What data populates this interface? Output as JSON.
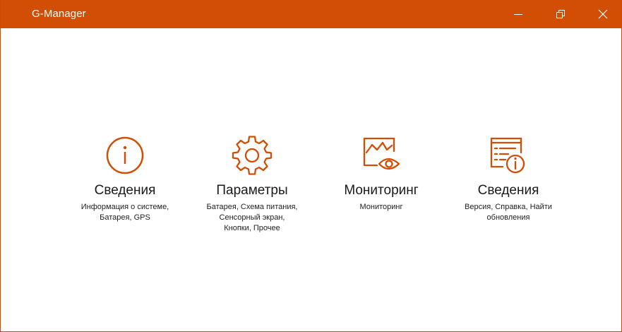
{
  "window": {
    "title": "G-Manager",
    "accent_color": "#d34e05",
    "controls": {
      "minimize_icon": "minimize-icon",
      "maximize_icon": "restore-icon",
      "close_icon": "close-icon"
    }
  },
  "tiles": [
    {
      "icon": "info-circle-icon",
      "heading": "Сведения",
      "description": "Информация о системе, Батарея, GPS"
    },
    {
      "icon": "gear-icon",
      "heading": "Параметры",
      "description": "Батарея, Схема питания, Сенсорный экран, Кнопки, Прочее"
    },
    {
      "icon": "monitoring-eye-icon",
      "heading": "Мониторинг",
      "description": "Мониторинг"
    },
    {
      "icon": "document-info-icon",
      "heading": "Сведения",
      "description": "Версия, Справка, Найти обновления"
    }
  ]
}
